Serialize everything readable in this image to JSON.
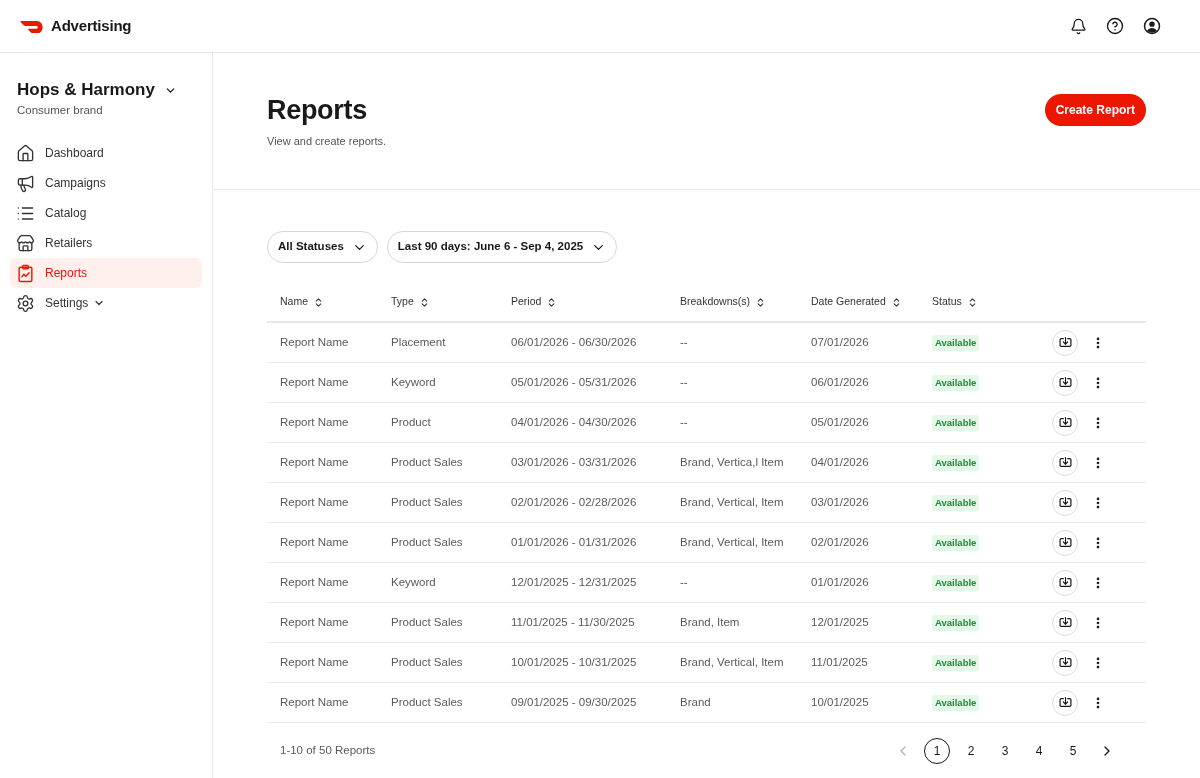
{
  "header": {
    "brand": "Advertising"
  },
  "sidebar": {
    "account": {
      "name": "Hops & Harmony",
      "subtitle": "Consumer brand"
    },
    "items": [
      {
        "label": "Dashboard",
        "kind": "link",
        "selected": false
      },
      {
        "label": "Campaigns",
        "kind": "link",
        "selected": false
      },
      {
        "label": "Catalog",
        "kind": "link",
        "selected": false
      },
      {
        "label": "Retailers",
        "kind": "link",
        "selected": false
      },
      {
        "label": "Reports",
        "kind": "link",
        "selected": true
      },
      {
        "label": "Settings",
        "kind": "group",
        "selected": false
      }
    ]
  },
  "page": {
    "title": "Reports",
    "subtitle": "View and create reports.",
    "create_button": "Create Report"
  },
  "filters": [
    {
      "label": "All Statuses"
    },
    {
      "label": "Last 90 days: June 6 - Sep 4, 2025"
    }
  ],
  "table": {
    "columns": [
      "Name",
      "Type",
      "Period",
      "Breakdowns(s)",
      "Date Generated",
      "Status"
    ],
    "rows": [
      {
        "name": "Report Name",
        "type": "Placement",
        "period": "06/01/2026 - 06/30/2026",
        "breakdowns": "--",
        "date_generated": "07/01/2026",
        "status": "Available"
      },
      {
        "name": "Report Name",
        "type": "Keyword",
        "period": "05/01/2026 - 05/31/2026",
        "breakdowns": "--",
        "date_generated": "06/01/2026",
        "status": "Available"
      },
      {
        "name": "Report Name",
        "type": "Product",
        "period": "04/01/2026 - 04/30/2026",
        "breakdowns": "--",
        "date_generated": "05/01/2026",
        "status": "Available"
      },
      {
        "name": "Report Name",
        "type": "Product Sales",
        "period": "03/01/2026 - 03/31/2026",
        "breakdowns": "Brand, Vertica,l Item",
        "date_generated": "04/01/2026",
        "status": "Available"
      },
      {
        "name": "Report Name",
        "type": "Product Sales",
        "period": "02/01/2026 - 02/28/2026",
        "breakdowns": "Brand, Vertical, Item",
        "date_generated": "03/01/2026",
        "status": "Available"
      },
      {
        "name": "Report Name",
        "type": "Product Sales",
        "period": "01/01/2026 - 01/31/2026",
        "breakdowns": "Brand, Vertical, Item",
        "date_generated": "02/01/2026",
        "status": "Available"
      },
      {
        "name": "Report Name",
        "type": "Keyword",
        "period": "12/01/2025 - 12/31/2025",
        "breakdowns": "--",
        "date_generated": "01/01/2026",
        "status": "Available"
      },
      {
        "name": "Report Name",
        "type": "Product Sales",
        "period": "11/01/2025 - 11/30/2025",
        "breakdowns": "Brand, Item",
        "date_generated": "12/01/2025",
        "status": "Available"
      },
      {
        "name": "Report Name",
        "type": "Product Sales",
        "period": "10/01/2025 - 10/31/2025",
        "breakdowns": "Brand, Vertical, Item",
        "date_generated": "11/01/2025",
        "status": "Available"
      },
      {
        "name": "Report Name",
        "type": "Product Sales",
        "period": "09/01/2025 - 09/30/2025",
        "breakdowns": "Brand",
        "date_generated": "10/01/2025",
        "status": "Available"
      }
    ]
  },
  "footer": {
    "summary": "1-10 of 50 Reports",
    "pagination": {
      "prev_disabled": true,
      "next_disabled": false,
      "pages": [
        {
          "label": "1",
          "selected": true
        },
        {
          "label": "2",
          "selected": false
        },
        {
          "label": "3",
          "selected": false
        },
        {
          "label": "4",
          "selected": false
        },
        {
          "label": "5",
          "selected": false
        }
      ]
    }
  }
}
